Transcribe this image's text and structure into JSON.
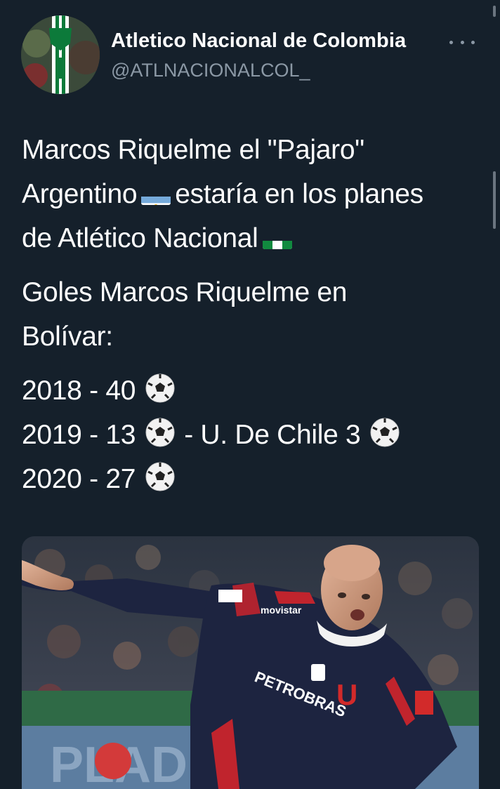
{
  "account": {
    "display_name": "Atletico Nacional de Colombia",
    "handle": "@ATLNACIONALCOL_"
  },
  "tweet": {
    "lines_p1": [
      "Marcos Riquelme el \"Pajaro\"",
      "Argentino",
      "estaría en los planes",
      "de Atlético Nacional"
    ],
    "lines_p2": [
      "Goles Marcos Riquelme en",
      "Bolívar:"
    ],
    "stats": {
      "row1": "2018 - 40",
      "row2a": "2019 - 13",
      "row2b": "- U. De Chile 3",
      "row3": "2020 - 27"
    }
  },
  "media": {
    "jersey_sponsor": "PETROBRAS",
    "jersey_sponsor2": "movistar",
    "crest_letter": "U"
  },
  "icons": {
    "more": "more-horizontal-icon",
    "flag_argentina": "argentina-flag-icon",
    "flag_nigeria": "green-white-flag-icon",
    "soccer_ball": "soccer-ball-icon"
  },
  "colors": {
    "background": "#15202b",
    "secondary_text": "#8b98a5"
  }
}
